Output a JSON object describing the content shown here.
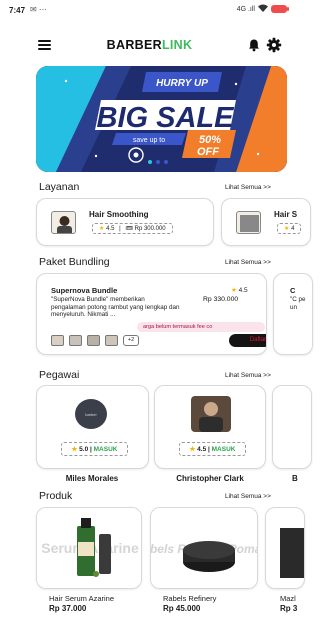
{
  "status_bar": {
    "time": "7:47",
    "left_icons": "✉ ⋯",
    "network": "4G .ıll",
    "battery_color": "#ef4d4d"
  },
  "header": {
    "brand_part1": "BARBER",
    "brand_part2": "LINK",
    "accent_color": "#3cbc5b"
  },
  "banner": {
    "hurry": "HURRY UP",
    "headline": "BIG SALE",
    "save_text": "save up to",
    "percent": "50%",
    "off": "OFF"
  },
  "sections": {
    "services_title": "Layanan",
    "bundles_title": "Paket Bundling",
    "staff_title": "Pegawai",
    "products_title": "Produk",
    "see_all": "Lihat Semua >>"
  },
  "services": [
    {
      "name": "Hair Smoothing",
      "rating": "4.5",
      "price": "Rp 300.000"
    },
    {
      "name": "Hair S",
      "rating": "4"
    }
  ],
  "bundles": [
    {
      "name": "Supernova Bundle",
      "rating": "4.5",
      "description": "\"SuperNova Bundle\" memberikan pengalaman potong rambut yang lengkap dan menyeluruh. Nikmati ...",
      "price": "Rp 330.000",
      "note": "arga belum termasuk fee co",
      "extra_count": "+2",
      "button_label": "Daftar"
    },
    {
      "name": "C",
      "description": "\"C pe un"
    }
  ],
  "staff": [
    {
      "name": "Miles Morales",
      "rating": "5.0",
      "status": "MASUK"
    },
    {
      "name": "Christopher Clark",
      "rating": "4.5",
      "status": "MASUK"
    },
    {
      "name": "B"
    }
  ],
  "products": [
    {
      "name": "Hair Serum Azarine",
      "price": "Rp 37.000",
      "image_text": "Serum Azarine"
    },
    {
      "name": "Rabels Refinery",
      "price": "Rp 45.000",
      "image_text": "Rabels Refinery Pomade"
    },
    {
      "name": "Mazl",
      "price": "Rp 3"
    }
  ]
}
